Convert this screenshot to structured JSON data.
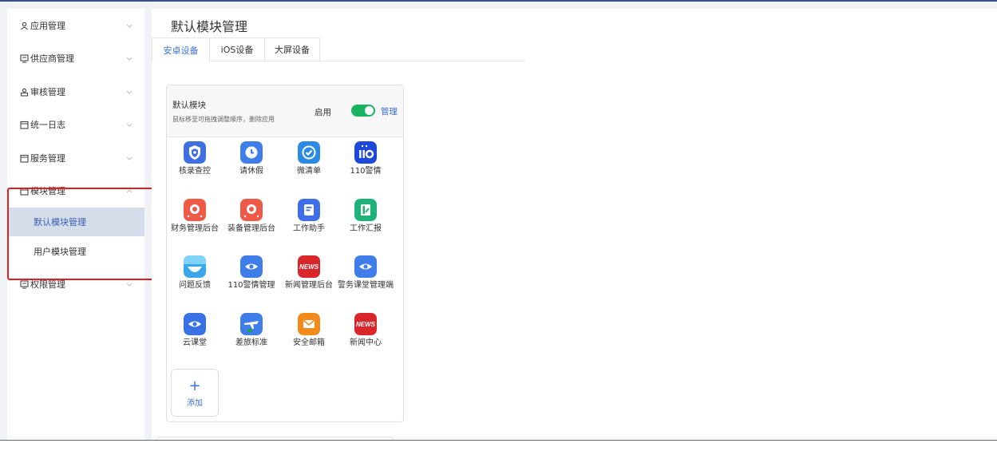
{
  "sidebar": {
    "items": [
      {
        "label": "应用管理",
        "icon": "user-icon"
      },
      {
        "label": "供应商管理",
        "icon": "monitor-icon"
      },
      {
        "label": "审核管理",
        "icon": "audit-icon"
      },
      {
        "label": "统一日志",
        "icon": "calendar-icon"
      },
      {
        "label": "服务管理",
        "icon": "calendar-icon"
      },
      {
        "label": "模块管理",
        "icon": "calendar-icon"
      },
      {
        "label": "权限管理",
        "icon": "monitor-icon"
      }
    ],
    "submenu": [
      {
        "label": "默认模块管理",
        "active": true
      },
      {
        "label": "用户模块管理",
        "active": false
      }
    ]
  },
  "main": {
    "title": "默认模块管理",
    "tabs": [
      {
        "label": "安卓设备",
        "active": true
      },
      {
        "label": "iOS设备",
        "active": false
      },
      {
        "label": "大屏设备",
        "active": false
      }
    ],
    "card": {
      "title": "默认模块",
      "subtitle": "鼠标移至可拖拽调整顺序，删除应用",
      "enable_label": "启用",
      "enabled": true,
      "manage_label": "管理",
      "apps": [
        {
          "label": "核录查控",
          "icon": "shield-icon",
          "color": "#3f6fe0"
        },
        {
          "label": "请休假",
          "icon": "clock-icon",
          "color": "#3f7ee8"
        },
        {
          "label": "微清单",
          "icon": "checkmark-icon",
          "color": "#2a8ae6"
        },
        {
          "label": "110警情",
          "icon": "110-icon",
          "color": "#1d49d8"
        },
        {
          "label": "财务管理后台",
          "icon": "finance-icon",
          "color": "#ef5a48"
        },
        {
          "label": "装备管理后台",
          "icon": "equipment-icon",
          "color": "#ef5a48"
        },
        {
          "label": "工作助手",
          "icon": "document-icon",
          "color": "#3f6fe8"
        },
        {
          "label": "工作汇报",
          "icon": "report-icon",
          "color": "#1fb37a"
        },
        {
          "label": "问题反馈",
          "icon": "feedback-icon",
          "color": "#3aa6ec"
        },
        {
          "label": "110警情管理",
          "icon": "eye-icon",
          "color": "#3f7ee8"
        },
        {
          "label": "新闻管理后台",
          "icon": "news-icon",
          "color": "#d8262b"
        },
        {
          "label": "警务课堂管理端",
          "icon": "eye-icon",
          "color": "#3f7ee8"
        },
        {
          "label": "云课堂",
          "icon": "eye-icon",
          "color": "#3a72e4"
        },
        {
          "label": "差旅标准",
          "icon": "airplane-icon",
          "color": "#3f7ee8"
        },
        {
          "label": "安全邮箱",
          "icon": "mail-icon",
          "color": "#f28a1a"
        },
        {
          "label": "新闻中心",
          "icon": "news-icon",
          "color": "#d8262b"
        }
      ],
      "news_text": "NEWS",
      "add_label": "添加",
      "add_symbol": "+"
    }
  }
}
